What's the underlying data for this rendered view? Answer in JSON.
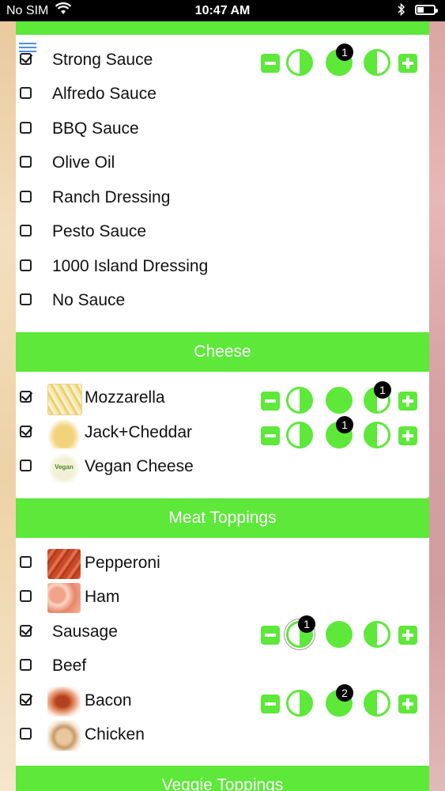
{
  "status_bar": {
    "carrier": "No SIM",
    "time": "10:47 AM"
  },
  "sections": {
    "cheese": {
      "title": "Cheese"
    },
    "meat": {
      "title": "Meat Toppings"
    },
    "veggie": {
      "title": "Veggie Toppings"
    }
  },
  "sauces": [
    {
      "label": "Strong Sauce",
      "checked": true,
      "badge": "1"
    },
    {
      "label": "Alfredo Sauce",
      "checked": false
    },
    {
      "label": "BBQ Sauce",
      "checked": false
    },
    {
      "label": "Olive Oil",
      "checked": false
    },
    {
      "label": "Ranch Dressing",
      "checked": false
    },
    {
      "label": "Pesto Sauce",
      "checked": false
    },
    {
      "label": "1000 Island Dressing",
      "checked": false
    },
    {
      "label": "No Sauce",
      "checked": false
    }
  ],
  "cheeses": [
    {
      "label": "Mozzarella",
      "checked": true,
      "badge": "1"
    },
    {
      "label": "Jack+Cheddar",
      "checked": true,
      "badge": "1"
    },
    {
      "label": "Vegan Cheese",
      "checked": false,
      "thumb_text": "Vegan"
    }
  ],
  "meats": [
    {
      "label": "Pepperoni",
      "checked": false
    },
    {
      "label": "Ham",
      "checked": false
    },
    {
      "label": "Sausage",
      "checked": true,
      "badge": "1"
    },
    {
      "label": "Beef",
      "checked": false
    },
    {
      "label": "Bacon",
      "checked": true,
      "badge": "2"
    },
    {
      "label": "Chicken",
      "checked": false
    }
  ],
  "colors": {
    "accent": "#5de83a",
    "badge": "#000000"
  },
  "icons": {
    "menu": "hamburger-icon",
    "minus": "minus-icon",
    "plus": "plus-icon",
    "left_half": "left-half-circle-icon",
    "whole": "whole-circle-icon",
    "right_half": "right-half-circle-icon",
    "wifi": "wifi-icon",
    "bluetooth": "bluetooth-icon",
    "battery": "battery-icon"
  }
}
